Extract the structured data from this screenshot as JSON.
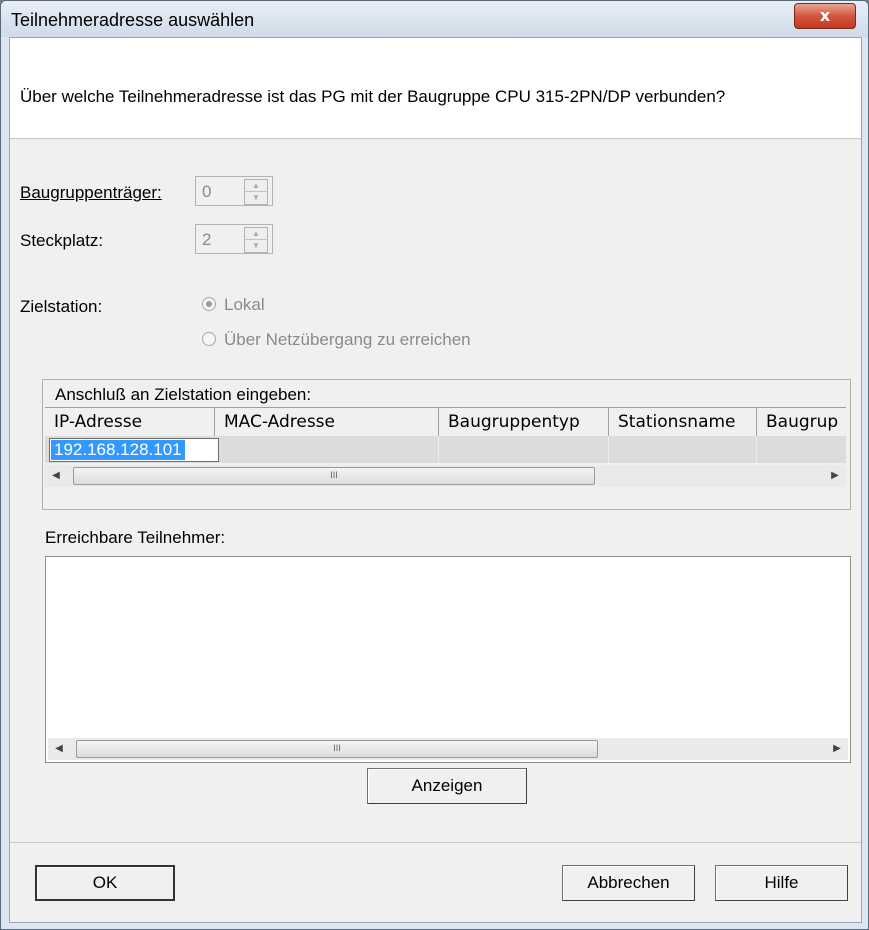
{
  "window": {
    "title": "Teilnehmeradresse auswählen",
    "close_glyph": "x"
  },
  "question": "Über welche Teilnehmeradresse ist das PG mit der Baugruppe CPU 315-2PN/DP verbunden?",
  "rack": {
    "label": "Baugruppenträger:",
    "value": "0"
  },
  "slot": {
    "label": "Steckplatz:",
    "value": "2"
  },
  "target": {
    "label": "Zielstation:",
    "options": [
      {
        "label": "Lokal",
        "selected": true
      },
      {
        "label": "Über Netzübergang zu erreichen",
        "selected": false
      }
    ]
  },
  "connection": {
    "caption": "Anschluß an Zielstation eingeben:",
    "columns": [
      "IP-Adresse",
      "MAC-Adresse",
      "Baugruppentyp",
      "Stationsname",
      "Baugrup"
    ],
    "row": {
      "ip": "192.168.128.101"
    }
  },
  "reachable": {
    "caption": "Erreichbare Teilnehmer:"
  },
  "scroll": {
    "left_arrow": "◀",
    "right_arrow": "▶",
    "grip": "III"
  },
  "spin": {
    "up": "▲",
    "down": "▼"
  },
  "buttons": {
    "show": "Anzeigen",
    "ok": "OK",
    "cancel": "Abbrechen",
    "help": "Hilfe"
  }
}
